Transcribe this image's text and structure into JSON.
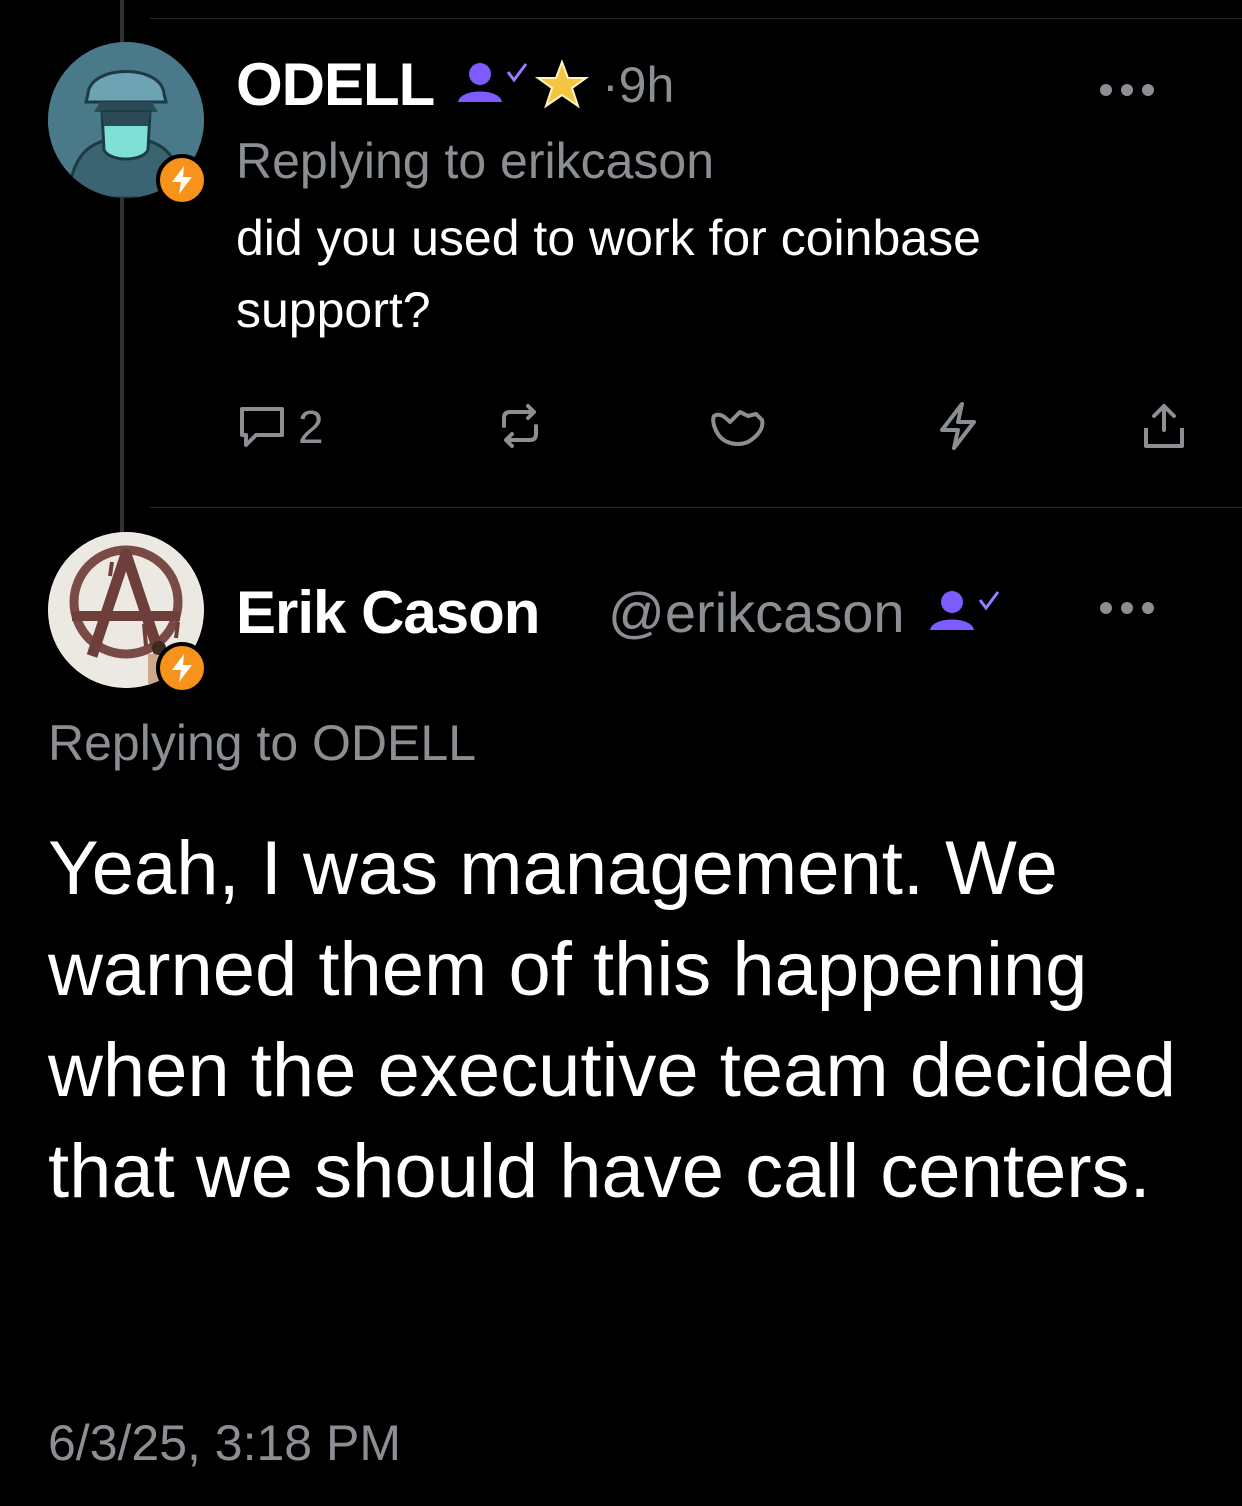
{
  "colors": {
    "background": "#000000",
    "text_primary": "#ffffff",
    "text_secondary": "#8b8f94",
    "zap_badge": "#f7931a",
    "verified_purple": "#7c5cff",
    "star_gold": "#f5c542"
  },
  "parent_post": {
    "author_name": "ODELL",
    "time_separator": "·",
    "time_ago": "9h",
    "replying_to": "Replying to erikcason",
    "content": "did you used to work for coinbase support?",
    "reply_count": "2",
    "icons": [
      "person-check-icon",
      "star-icon",
      "more-icon",
      "reply-icon",
      "repost-icon",
      "like-icon",
      "zap-icon",
      "share-icon"
    ]
  },
  "main_post": {
    "author_name": "Erik Cason",
    "handle": "@erikcason",
    "replying_to": "Replying to ODELL",
    "content": "Yeah, I was management. We warned them of this happening when the executive team decided that we should have call centers.",
    "timestamp": "6/3/25, 3:18 PM",
    "icons": [
      "person-check-icon",
      "more-icon"
    ]
  }
}
